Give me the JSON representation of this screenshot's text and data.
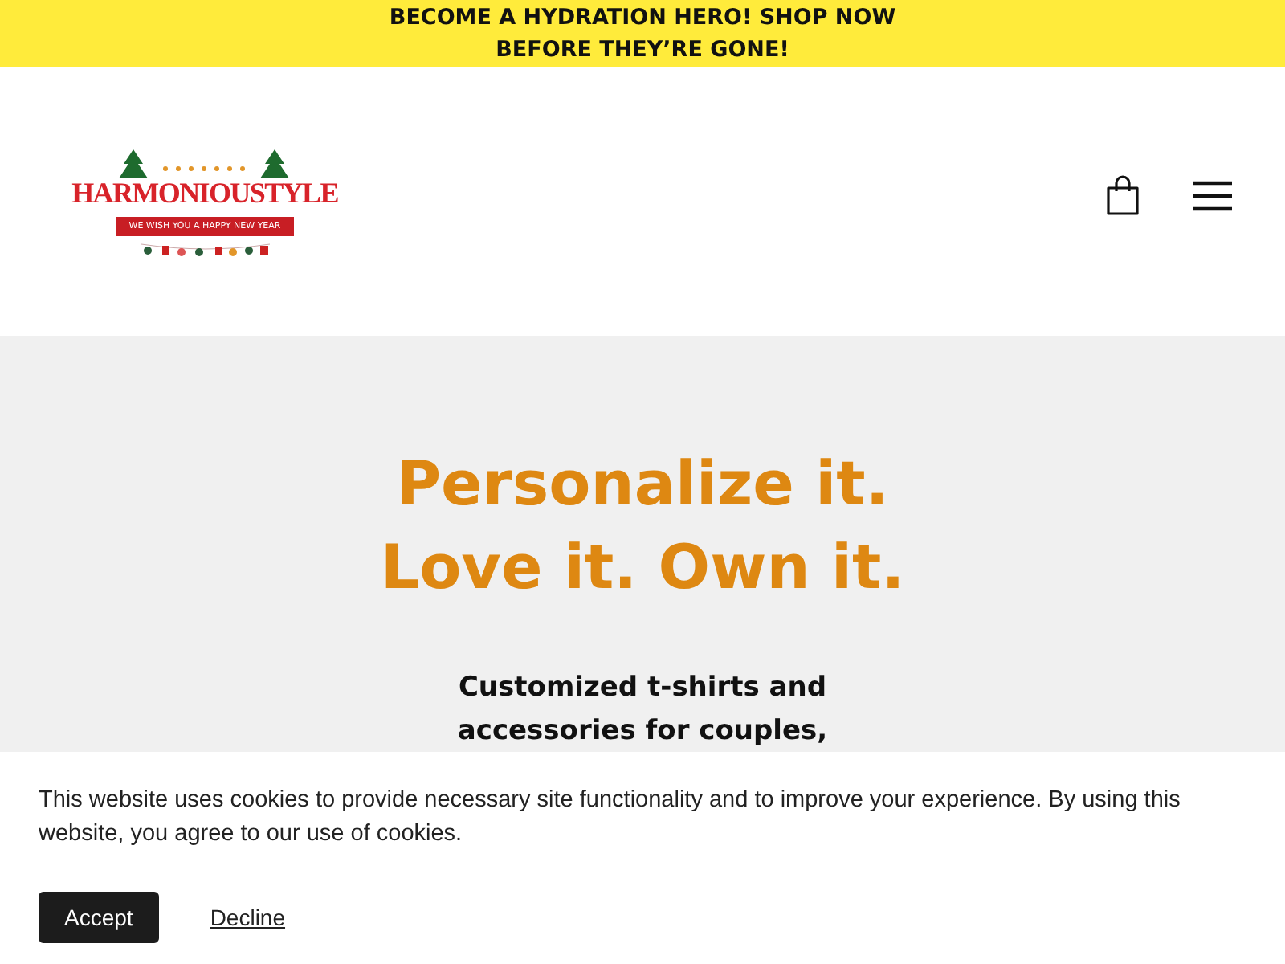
{
  "announcement": {
    "lines": [
      "BECOME A HYDRATION HERO! SHOP NOW",
      "BEFORE THEY’RE GONE!"
    ]
  },
  "header": {
    "logo": {
      "name": "HARMONIOUSTYLE",
      "ribbon": "WE WISH YOU A HAPPY NEW YEAR"
    }
  },
  "hero": {
    "heading_lines": [
      "Personalize it.",
      "Love it. Own it."
    ],
    "subheading_lines": [
      "Customized t-shirts and",
      "accessories for couples,"
    ]
  },
  "cookie_banner": {
    "message": "This website uses cookies to provide necessary site functionality and to improve your experience. By using this website, you agree to our use of cookies.",
    "buttons": [
      {
        "kind": "primary",
        "label": "Accept"
      },
      {
        "kind": "link",
        "label": "Decline"
      }
    ]
  }
}
